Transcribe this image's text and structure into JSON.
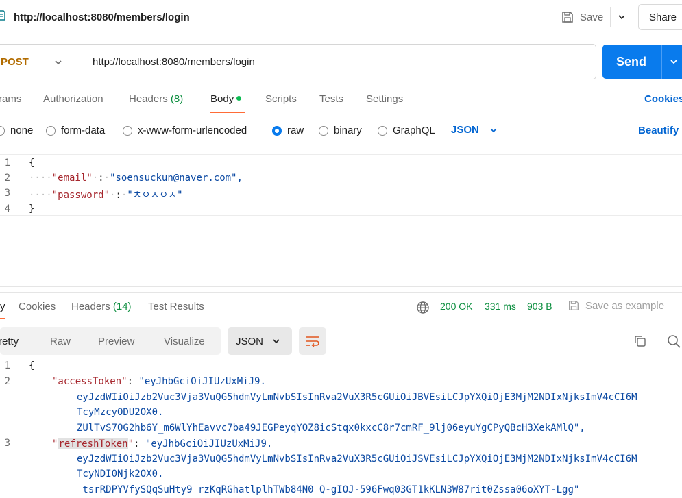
{
  "titlebar": {
    "title": "http://localhost:8080/members/login",
    "save_label": "Save",
    "share_label": "Share"
  },
  "request": {
    "method": "POST",
    "url": "http://localhost:8080/members/login",
    "send_label": "Send"
  },
  "request_tabs": {
    "params": "rams",
    "authorization": "Authorization",
    "headers": "Headers",
    "headers_count": "(8)",
    "body": "Body",
    "scripts": "Scripts",
    "tests": "Tests",
    "settings": "Settings",
    "cookies": "Cookies"
  },
  "body_types": {
    "none": "none",
    "form_data": "form-data",
    "urlencoded": "x-www-form-urlencoded",
    "raw": "raw",
    "binary": "binary",
    "graphql": "GraphQL",
    "language": "JSON",
    "beautify": "Beautify"
  },
  "request_body": {
    "line_numbers": [
      "1",
      "2",
      "3",
      "4"
    ],
    "open_brace": "{",
    "close_brace": "}",
    "email_key": "\"email\"",
    "email_value": "\"soensuckun@naver.com\",",
    "password_key": "\"password\"",
    "password_value": "\"ㅊㅇㅈㅇㅈ\""
  },
  "response_tabs": {
    "body": "y",
    "cookies": "Cookies",
    "headers": "Headers",
    "headers_count": "(14)",
    "test_results": "Test Results",
    "status": "200 OK",
    "time": "331 ms",
    "size": "903 B",
    "save_example": "Save as example"
  },
  "response_format": {
    "pretty": "retty",
    "raw": "Raw",
    "preview": "Preview",
    "visualize": "Visualize",
    "language": "JSON"
  },
  "response_body": {
    "line_numbers": [
      "1",
      "2",
      "3"
    ],
    "open_brace": "{",
    "access_key": "\"accessToken\"",
    "access_line1": "\"eyJhbGciOiJIUzUxMiJ9.",
    "access_line2": "eyJzdWIiOiJzb2Vuc3Vja3VuQG5hdmVyLmNvbSIsInRva2VuX3R5cGUiOiJBVEsiLCJpYXQiOjE3MjM2NDIxNjksImV4cCI6M",
    "access_line3": "TcyMzcyODU2OX0.",
    "access_line4": "ZUlTvS7OG2hb6Y_m6WlYhEavvc7ba49JEGPeyqYOZ8icStqx0kxcC8r7cmRF_9lj06eyuYgCPyQBcH3XekAMlQ\",",
    "refresh_key": "refreshToken",
    "refresh_line1": "\"eyJhbGciOiJIUzUxMiJ9.",
    "refresh_line2": "eyJzdWIiOiJzb2Vuc3Vja3VuQG5hdmVyLmNvbSIsInRva2VuX3R5cGUiOiJSVEsiLCJpYXQiOjE3MjM2NDIxNjksImV4cCI6M",
    "refresh_line3": "TcyNDI0Njk2OX0.",
    "refresh_line4": "_tsrRDPYVfySQqSuHty9_rzKqRGhatlplhTWb84N0_Q-gIOJ-596Fwq03GT1kKLN3W87rit0Zssa06oXYT-Lgg\""
  },
  "colors": {
    "accent": "#097bed",
    "tab_underline": "#ff6c37",
    "method": "#b26c00",
    "status_ok": "#0c8e3f"
  }
}
